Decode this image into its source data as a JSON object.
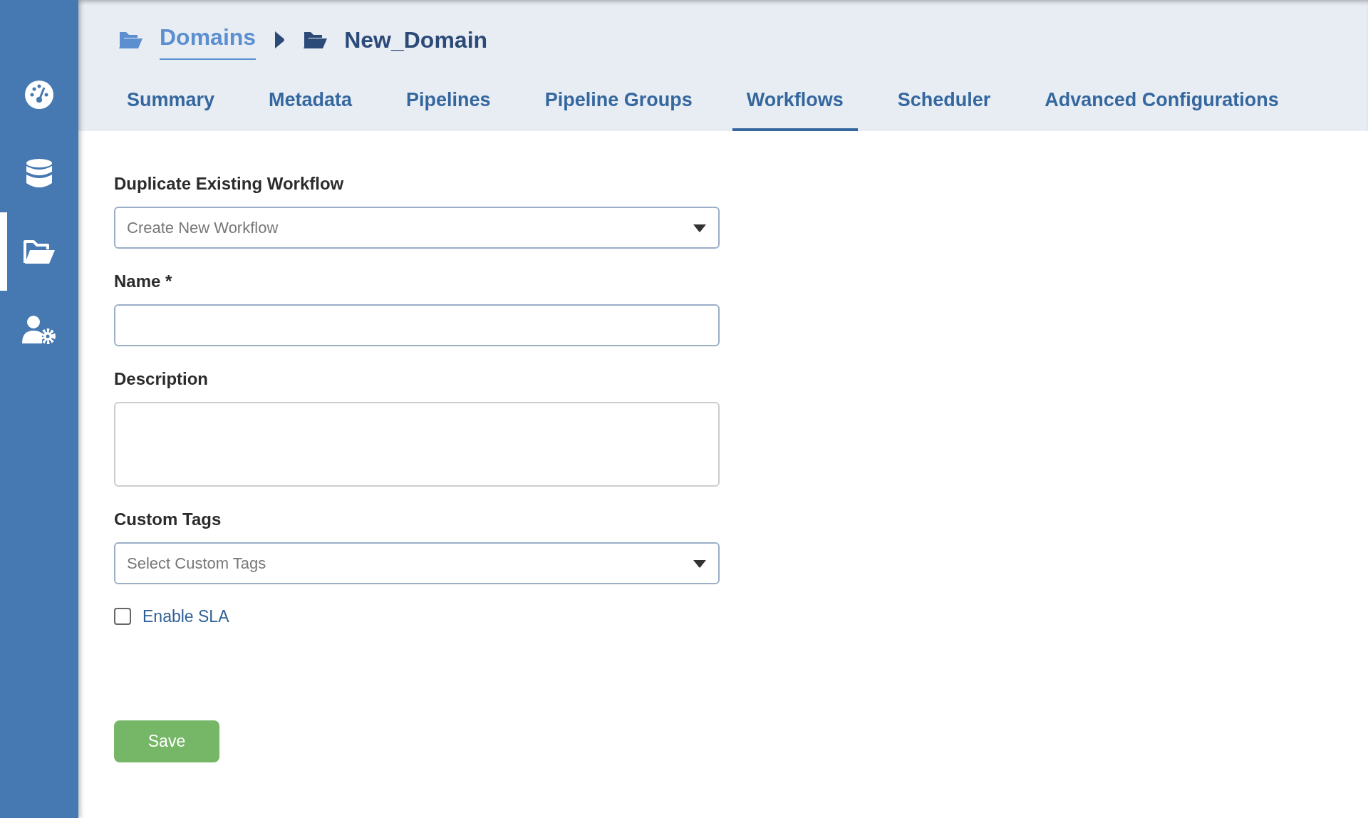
{
  "sidebar": {
    "items": [
      {
        "kind": "dashboard",
        "selected": false
      },
      {
        "kind": "database",
        "selected": false
      },
      {
        "kind": "folder",
        "selected": true
      },
      {
        "kind": "users",
        "selected": false
      }
    ]
  },
  "breadcrumb": [
    {
      "label": "Domains",
      "current": false
    },
    {
      "label": "New_Domain",
      "current": true
    }
  ],
  "tabs": [
    {
      "label": "Summary",
      "selected": false
    },
    {
      "label": "Metadata",
      "selected": false
    },
    {
      "label": "Pipelines",
      "selected": false
    },
    {
      "label": "Pipeline Groups",
      "selected": false
    },
    {
      "label": "Workflows",
      "selected": true
    },
    {
      "label": "Scheduler",
      "selected": false
    },
    {
      "label": "Advanced Configurations",
      "selected": false
    }
  ],
  "form": {
    "fields": [
      {
        "kind": "select",
        "label": "Duplicate Existing Workflow",
        "placeholder": "Create New Workflow"
      },
      {
        "kind": "input",
        "label": "Name *"
      },
      {
        "kind": "textarea",
        "label": "Description"
      },
      {
        "kind": "select",
        "label": "Custom Tags",
        "placeholder": "Select Custom Tags"
      },
      {
        "kind": "checkbox",
        "label": "Enable SLA",
        "checked": false
      }
    ],
    "save_button": "Save"
  }
}
